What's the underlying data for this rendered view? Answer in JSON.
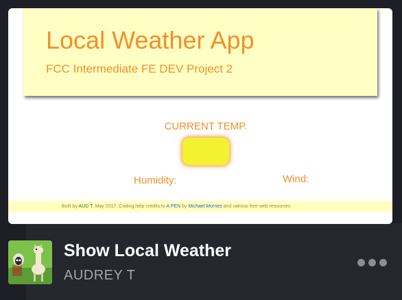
{
  "preview": {
    "app_title": "Local Weather App",
    "app_subtitle": "FCC Intermediate FE DEV Project 2",
    "temp_label": "CURRENT TEMP.",
    "humidity_label": "Humidity:",
    "wind_label": "Wind:",
    "footer": {
      "part1": "Built by ",
      "author": "AUD T",
      "part2": ", May 2017.  Coding help credits to ",
      "pen": "A PEN",
      "part3": " by ",
      "michael": "Michael Morries",
      "part4": " and various free web resources"
    }
  },
  "pen": {
    "title": "Show Local Weather",
    "author": "AUDREY T"
  },
  "icons": {
    "avatar": "shaun-the-sheep-avatar-icon",
    "more": "more-options-icon"
  },
  "colors": {
    "background": "#1e1f26",
    "accent_orange": "#f0902a",
    "banner_yellow": "#ffffc4",
    "temp_yellow": "#f2f230",
    "title_text": "#ffffff",
    "author_text": "#a3a6ad"
  }
}
